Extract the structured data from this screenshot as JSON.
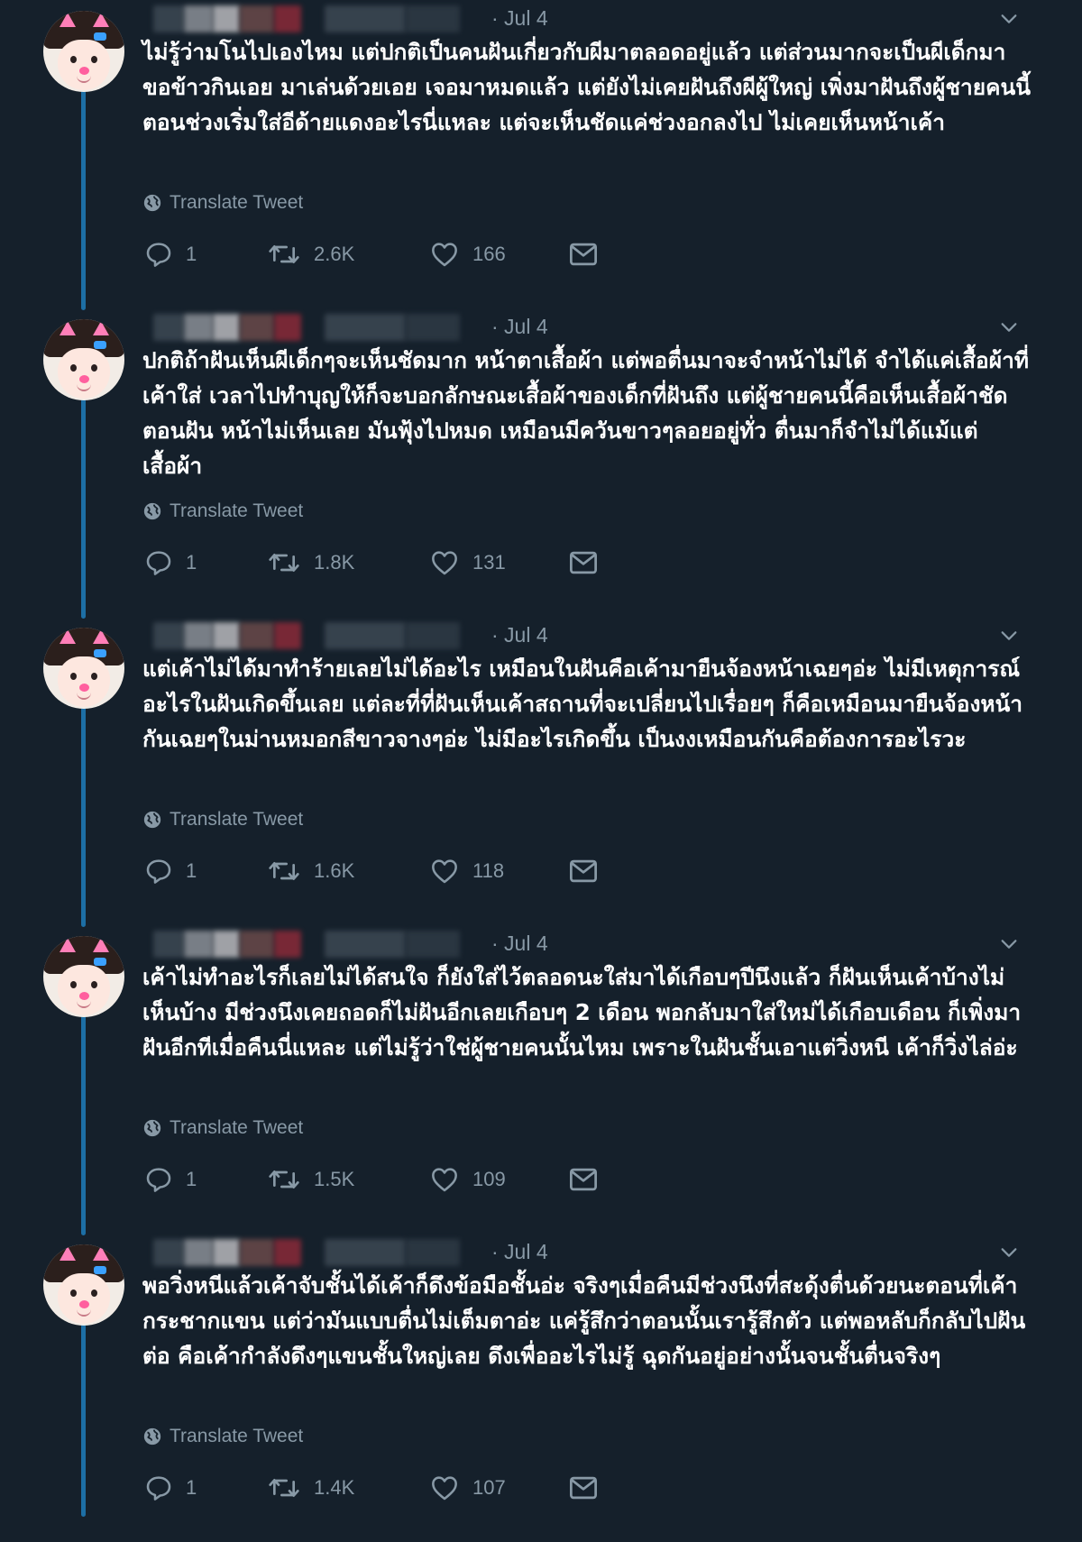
{
  "tweets": [
    {
      "date": "· Jul 4",
      "text": "ไม่รู้ว่ามโนไปเองไหม แต่ปกติเป็นคนฝันเกี่ยวกับผีมาตลอดอยู่แล้ว แต่ส่วนมากจะเป็นผีเด็กมาขอข้าวกินเอย มาเล่นด้วยเอย เจอมาหมดแล้ว แต่ยังไม่เคยฝันถึงผีผู้ใหญ่ เพิ่งมาฝันถึงผู้ชายคนนี้ตอนช่วงเริ่มใส่อีด้ายแดงอะไรนี่แหละ แต่จะเห็นชัดแค่ช่วงอกลงไป ไม่เคยเห็นหน้าเค้า",
      "translate": "Translate Tweet",
      "replies": "1",
      "retweets": "2.6K",
      "likes": "166"
    },
    {
      "date": "· Jul 4",
      "text": "ปกติถ้าฝันเห็นผีเด็กๆจะเห็นชัดมาก หน้าตาเสื้อผ้า แต่พอตื่นมาจะจำหน้าไม่ได้ จำได้แค่เสื้อผ้าที่เค้าใส่ เวลาไปทำบุญให้ก็จะบอกลักษณะเสื้อผ้าของเด็กที่ฝันถึง แต่ผู้ชายคนนี้คือเห็นเสื้อผ้าชัดตอนฝัน หน้าไม่เห็นเลย มันฟุ้งไปหมด เหมือนมีควันขาวๆลอยอยู่ทั่ว ตื่นมาก็จำไม่ได้แม้แต่เสื้อผ้า",
      "translate": "Translate Tweet",
      "replies": "1",
      "retweets": "1.8K",
      "likes": "131"
    },
    {
      "date": "· Jul 4",
      "text": "แต่เค้าไม่ได้มาทำร้ายเลยไม่ได้อะไร เหมือนในฝันคือเค้ามายืนจ้องหน้าเฉยๆอ่ะ ไม่มีเหตุการณ์อะไรในฝันเกิดขึ้นเลย แต่ละที่ที่ฝันเห็นเค้าสถานที่จะเปลี่ยนไปเรื่อยๆ ก็คือเหมือนมายืนจ้องหน้ากันเฉยๆในม่านหมอกสีขาวจางๆอ่ะ ไม่มีอะไรเกิดขึ้น เป็นงงเหมือนกันคือต้องการอะไรวะ",
      "translate": "Translate Tweet",
      "replies": "1",
      "retweets": "1.6K",
      "likes": "118"
    },
    {
      "date": "· Jul 4",
      "text": "เค้าไม่ทำอะไรก็เลยไม่ได้สนใจ ก็ยังใส่ไว้ตลอดนะใส่มาได้เกือบๆปีนึงแล้ว ก็ฝันเห็นเค้าบ้างไม่เห็นบ้าง มีช่วงนึงเคยถอดก็ไม่ฝันอีกเลยเกือบๆ 2 เดือน พอกลับมาใส่ใหม่ได้เกือบเดือน ก็เพิ่งมาฝันอีกทีเมื่อคืนนี่แหละ แต่ไม่รู้ว่าใช่ผู้ชายคนนั้นไหม เพราะในฝันชั้นเอาแต่วิ่งหนี เค้าก็วิ่งไล่อ่ะ",
      "translate": "Translate Tweet",
      "replies": "1",
      "retweets": "1.5K",
      "likes": "109"
    },
    {
      "date": "· Jul 4",
      "text": "พอวิ่งหนีแล้วเค้าจับชั้นได้เค้าก็ดึงข้อมือชั้นอ่ะ จริงๆเมื่อคืนมีช่วงนึงที่สะดุ้งตื่นด้วยนะตอนที่เค้ากระชากแขน แต่ว่ามันแบบตื่นไม่เต็มตาอ่ะ แค่รู้สึกว่าตอนนั้นเรารู้สึกตัว แต่พอหลับก็กลับไปฝันต่อ คือเค้ากำลังดึงๆแขนชั้นใหญ่เลย ดึงเพื่ออะไรไม่รู้ ฉุดกันอยู่อย่างนั้นจนชั้นตื่นจริงๆ",
      "translate": "Translate Tweet",
      "replies": "1",
      "retweets": "1.4K",
      "likes": "107"
    }
  ],
  "colors": {
    "background": "#15202b",
    "thread_line": "#1d6fa5",
    "muted": "#8899a6",
    "text": "#ffffff"
  },
  "icons": [
    "reply-icon",
    "retweet-icon",
    "like-icon",
    "dm-icon",
    "globe-icon",
    "chevron-down-icon"
  ]
}
